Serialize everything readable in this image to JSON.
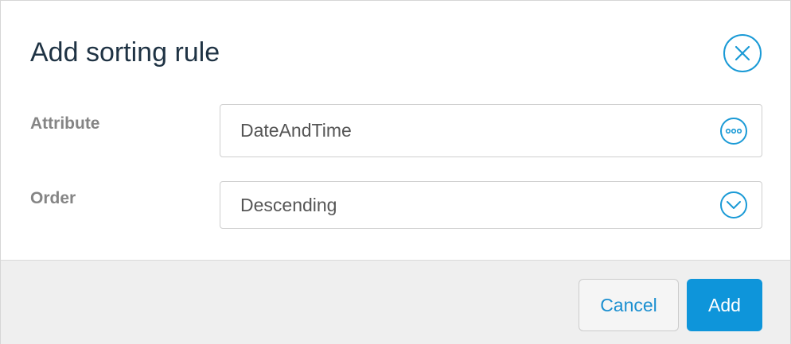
{
  "dialog": {
    "title": "Add sorting rule",
    "close_icon": "close-circle-icon"
  },
  "fields": {
    "attribute": {
      "label": "Attribute",
      "value": "DateAndTime",
      "icon": "ellipsis-circle-icon"
    },
    "order": {
      "label": "Order",
      "value": "Descending",
      "icon": "chevron-down-circle-icon"
    }
  },
  "footer": {
    "cancel_label": "Cancel",
    "add_label": "Add"
  },
  "colors": {
    "accent": "#1a9ad6",
    "primary_button": "#0e95da",
    "title_text": "#1f3344",
    "label_text": "#858585",
    "footer_bg": "#efefef"
  }
}
